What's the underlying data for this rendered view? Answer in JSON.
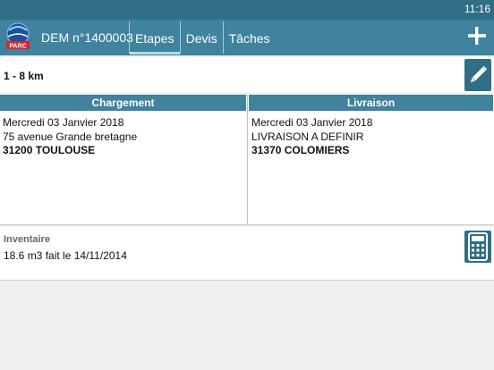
{
  "status_bar": {
    "time": "11:16"
  },
  "app_bar": {
    "logo_text": "PARC",
    "title": "DEM n°1400003",
    "tabs": [
      {
        "label": "Etapes",
        "active": true
      },
      {
        "label": "Devis",
        "active": false
      },
      {
        "label": "Tâches",
        "active": false
      }
    ],
    "add_icon": "plus-icon"
  },
  "route": {
    "distance": "1 - 8 km",
    "edit_icon": "pencil-icon"
  },
  "loading": {
    "header": "Chargement",
    "date": "Mercredi 03 Janvier 2018",
    "address": "75 avenue Grande bretagne",
    "zip_city": "31200 TOULOUSE"
  },
  "delivery": {
    "header": "Livraison",
    "date": "Mercredi 03 Janvier 2018",
    "address": "LIVRAISON A DEFINIR",
    "zip_city": "31370 COLOMIERS"
  },
  "inventory": {
    "label": "Inventaire",
    "value": "18.6 m3 fait le 14/11/2014",
    "calc_icon": "calculator-icon"
  },
  "colors": {
    "appbar": "#3f839e",
    "statusbar": "#2f6e85",
    "button": "#2f6e85"
  }
}
